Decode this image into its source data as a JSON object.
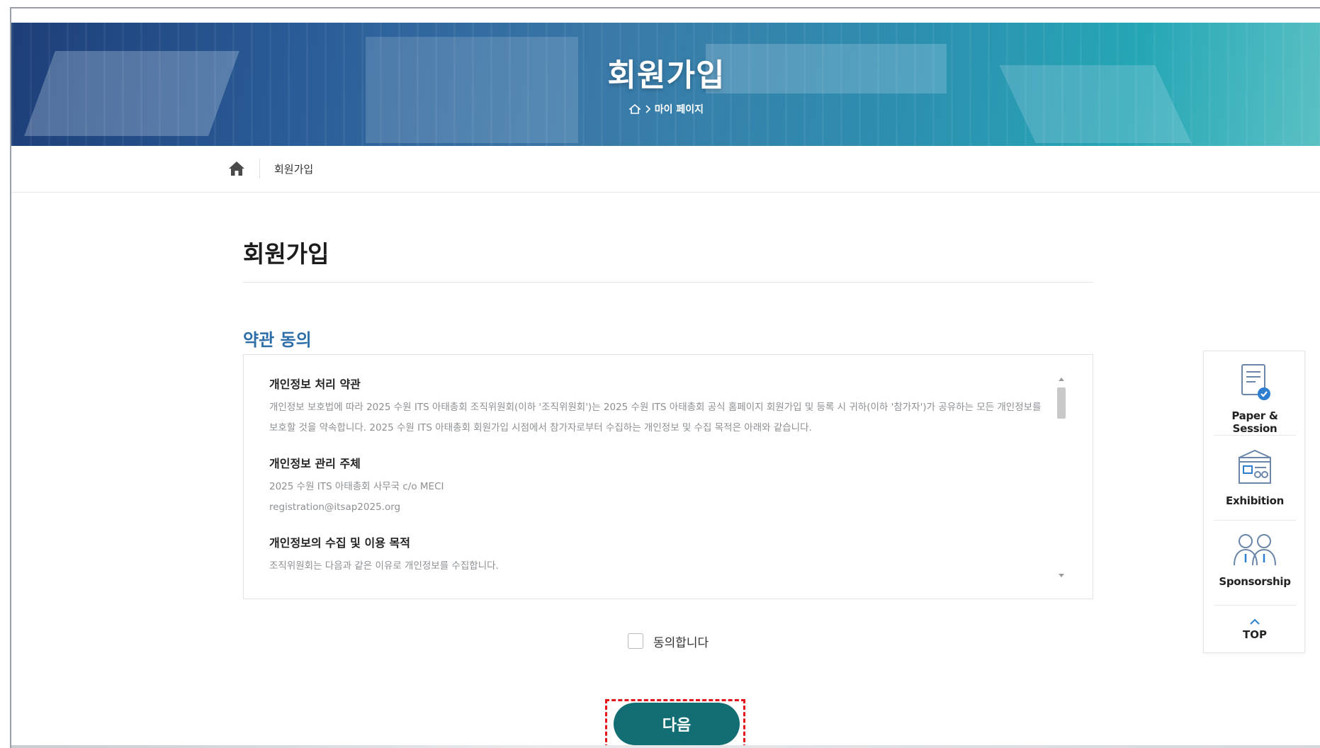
{
  "hero": {
    "title": "회원가입",
    "crumb": "마이 페이지"
  },
  "breadcrumb": {
    "current": "회원가입"
  },
  "page": {
    "title": "회원가입",
    "section_title": "약관 동의"
  },
  "terms": [
    {
      "heading": "개인정보 처리 약관",
      "body": "개인정보 보호법에 따라 2025 수원 ITS 아태총회 조직위원회(이하 '조직위원회')는 2025 수원 ITS 아태총회 공식 홈페이지 회원가입 및 등록 시 귀하(이하 '참가자')가 공유하는 모든 개인정보를 보호할 것을 약속합니다. 2025 수원 ITS 아태총회 회원가입 시점에서 참가자로부터 수집하는 개인정보 및 수집 목적은 아래와 같습니다."
    },
    {
      "heading": "개인정보 관리 주체",
      "lines": [
        "2025 수원 ITS 아태총회 사무국 c/o MECI",
        "registration@itsap2025.org"
      ]
    },
    {
      "heading": "개인정보의 수집 및 이용 목적",
      "body": "조직위원회는 다음과 같은 이유로 개인정보를 수집합니다."
    }
  ],
  "agree": {
    "label": "동의합니다",
    "checked": false
  },
  "next_button": {
    "label": "다음"
  },
  "quick_menu": {
    "items": [
      {
        "label": "Paper & Session",
        "icon": "paper-session-icon"
      },
      {
        "label": "Exhibition",
        "icon": "exhibition-icon"
      },
      {
        "label": "Sponsorship",
        "icon": "sponsorship-icon"
      }
    ],
    "top_label": "TOP"
  },
  "colors": {
    "accent": "#2d6ea8",
    "button": "#136e74",
    "highlight": "#e3151a"
  }
}
